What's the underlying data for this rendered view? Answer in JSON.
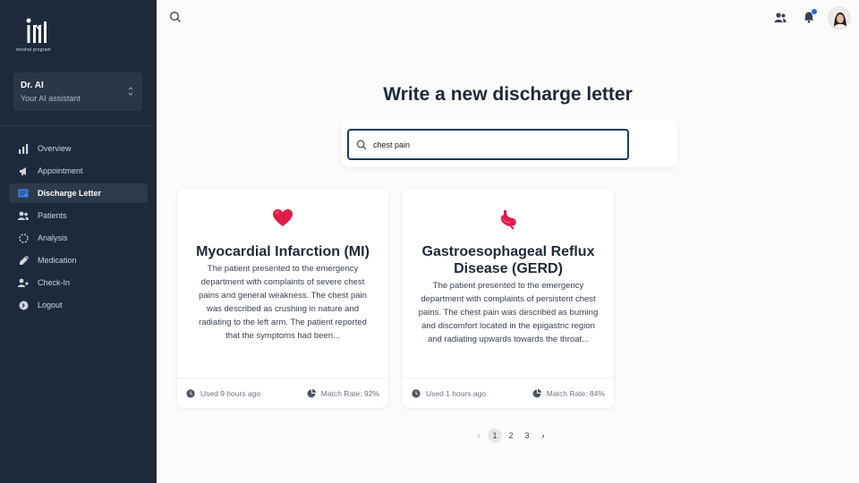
{
  "brand": {
    "name": "meshal program"
  },
  "assistant": {
    "name": "Dr. AI",
    "subtitle": "Your AI assistant"
  },
  "nav": [
    {
      "label": "Overview",
      "icon": "bar-chart-icon",
      "active": false
    },
    {
      "label": "Appointment",
      "icon": "megaphone-icon",
      "active": false
    },
    {
      "label": "Discharge Letter",
      "icon": "letter-icon",
      "active": true
    },
    {
      "label": "Patients",
      "icon": "users-icon",
      "active": false
    },
    {
      "label": "Analysis",
      "icon": "dashed-circle-icon",
      "active": false
    },
    {
      "label": "Medication",
      "icon": "syringe-icon",
      "active": false
    },
    {
      "label": "Check-In",
      "icon": "user-plus-icon",
      "active": false
    },
    {
      "label": "Logout",
      "icon": "logout-icon",
      "active": false
    }
  ],
  "main": {
    "title": "Write a new discharge letter",
    "search": {
      "value": "chest pain",
      "placeholder": ""
    }
  },
  "cards": [
    {
      "title": "Myocardial Infarction (MI)",
      "icon": "heart-icon",
      "description": "The patient presented to the emergency department with complaints of severe chest pains and general weakness. The chest pain was described as crushing in nature and radiating to the left arm. The patient reported that the symptoms had been...",
      "used": "Used 9 hours ago",
      "match": "Match Rate: 92%"
    },
    {
      "title": "Gastroesophageal Reflux Disease (GERD)",
      "icon": "stomach-icon",
      "description": "The patient presented to the emergency department with complaints of persistent chest pains. The chest pain was described as burning and discomfort located in the epigastric region and radiating upwards towards the throat...",
      "used": "Used 1 hours ago",
      "match": "Match Rate: 84%"
    }
  ],
  "pagination": {
    "prev": "‹",
    "pages": [
      "1",
      "2",
      "3"
    ],
    "current": "1",
    "next": "›"
  },
  "colors": {
    "sidebar": "#1e2a3b",
    "accent": "#2563eb",
    "card_icon": "#e11d48"
  }
}
